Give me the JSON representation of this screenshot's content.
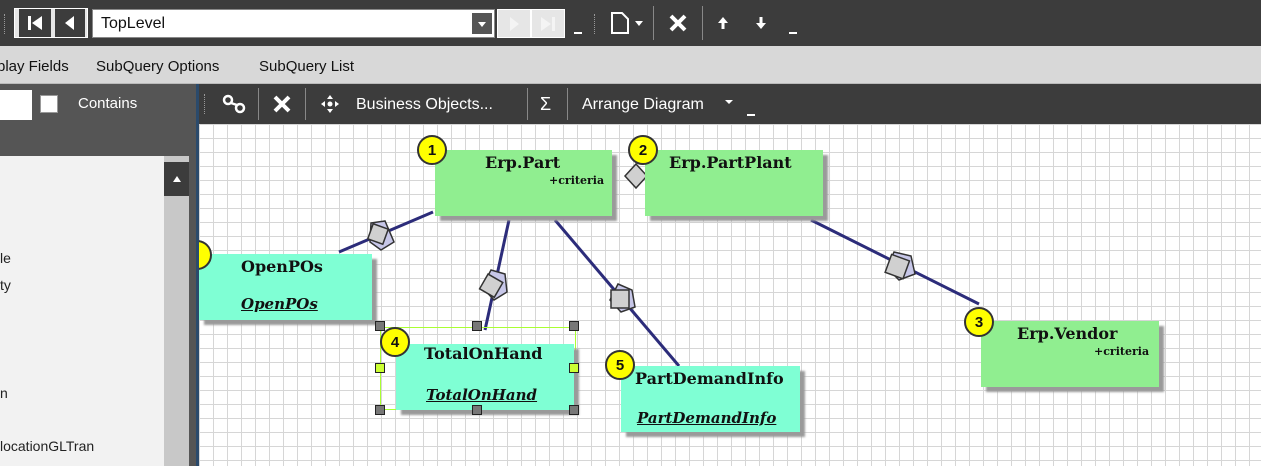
{
  "toolbar": {
    "combo_value": "TopLevel",
    "icons": [
      "first-icon",
      "previous-icon",
      "dropdown-icon",
      "next-icon",
      "last-icon",
      "new-document-icon",
      "delete-icon",
      "move-up-icon",
      "move-down-icon"
    ]
  },
  "menu": {
    "items": [
      {
        "label": "play Fields"
      },
      {
        "label": "SubQuery Options"
      },
      {
        "label": "SubQuery List"
      }
    ]
  },
  "left_panel": {
    "contains_label": "Contains",
    "items": [
      {
        "label": "le"
      },
      {
        "label": "ty"
      },
      {
        "label": "n"
      },
      {
        "label": "locationGLTran"
      }
    ]
  },
  "diagram_toolbar": {
    "business_objects_label": "Business Objects...",
    "sum_label": "Σ",
    "arrange_label": "Arrange Diagram"
  },
  "diagram": {
    "nodes": [
      {
        "badge": "1",
        "title": "Erp.Part",
        "criteria": "+criteria"
      },
      {
        "badge": "2",
        "title": "Erp.PartPlant"
      },
      {
        "badge": "3",
        "title": "Erp.Vendor",
        "criteria": "+criteria"
      },
      {
        "badge": "4",
        "title": "TotalOnHand",
        "subtitle": "TotalOnHand"
      },
      {
        "badge": "5",
        "title": "PartDemandInfo",
        "subtitle": "PartDemandInfo"
      },
      {
        "title": "OpenPOs",
        "subtitle": "OpenPOs"
      }
    ],
    "colors": {
      "table_node": "#90ee90",
      "subquery_node": "#7fffd4",
      "badge": "#ffff00",
      "link": "#2c2c7a"
    }
  }
}
